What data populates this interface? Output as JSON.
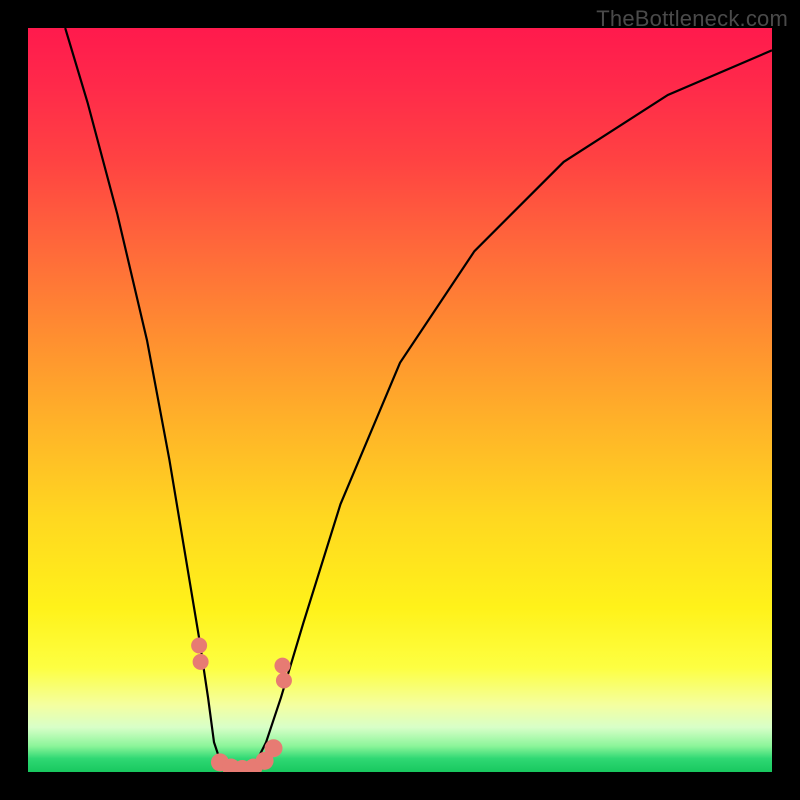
{
  "watermark": {
    "text": "TheBottleneck.com"
  },
  "chart_data": {
    "type": "line",
    "title": "",
    "xlabel": "",
    "ylabel": "",
    "xlim": [
      0,
      100
    ],
    "ylim": [
      0,
      100
    ],
    "background": {
      "type": "vertical_gradient",
      "stops": [
        {
          "pos": 0,
          "color": "#ff1a4d"
        },
        {
          "pos": 8,
          "color": "#ff2a4a"
        },
        {
          "pos": 18,
          "color": "#ff4342"
        },
        {
          "pos": 30,
          "color": "#ff6a3a"
        },
        {
          "pos": 42,
          "color": "#ff9030"
        },
        {
          "pos": 54,
          "color": "#ffb528"
        },
        {
          "pos": 66,
          "color": "#ffd820"
        },
        {
          "pos": 78,
          "color": "#fff21a"
        },
        {
          "pos": 86,
          "color": "#fdff42"
        },
        {
          "pos": 91,
          "color": "#f4ffa0"
        },
        {
          "pos": 94,
          "color": "#d8ffc8"
        },
        {
          "pos": 96.5,
          "color": "#8cf59a"
        },
        {
          "pos": 98.2,
          "color": "#2fd873"
        },
        {
          "pos": 100,
          "color": "#18c85f"
        }
      ]
    },
    "series": [
      {
        "name": "bottleneck-curve",
        "color": "#000000",
        "stroke_width": 2.2,
        "x": [
          5,
          8,
          12,
          16,
          19,
          21,
          23,
          24.2,
          25,
          26,
          27.5,
          29,
          30.5,
          32,
          34,
          37,
          42,
          50,
          60,
          72,
          86,
          100
        ],
        "y": [
          100,
          90,
          75,
          58,
          42,
          30,
          18,
          10,
          4,
          1,
          0,
          0,
          1,
          4,
          10,
          20,
          36,
          55,
          70,
          82,
          91,
          97
        ]
      }
    ],
    "markers": [
      {
        "name": "marker-left-pair-upper",
        "shape": "circle",
        "color": "#e77b73",
        "r": 8,
        "x": 23.0,
        "y": 17.0
      },
      {
        "name": "marker-left-pair-lower",
        "shape": "circle",
        "color": "#e77b73",
        "r": 8,
        "x": 23.2,
        "y": 14.8
      },
      {
        "name": "marker-right-pair-upper",
        "shape": "circle",
        "color": "#e77b73",
        "r": 8,
        "x": 34.2,
        "y": 14.3
      },
      {
        "name": "marker-right-pair-lower",
        "shape": "circle",
        "color": "#e77b73",
        "r": 8,
        "x": 34.4,
        "y": 12.3
      },
      {
        "name": "trough-marker-1",
        "shape": "circle",
        "color": "#e77b73",
        "r": 9,
        "x": 25.8,
        "y": 1.3
      },
      {
        "name": "trough-marker-2",
        "shape": "circle",
        "color": "#e77b73",
        "r": 9,
        "x": 27.3,
        "y": 0.6
      },
      {
        "name": "trough-marker-3",
        "shape": "circle",
        "color": "#e77b73",
        "r": 9,
        "x": 28.8,
        "y": 0.4
      },
      {
        "name": "trough-marker-4",
        "shape": "circle",
        "color": "#e77b73",
        "r": 9,
        "x": 30.3,
        "y": 0.6
      },
      {
        "name": "trough-marker-5",
        "shape": "circle",
        "color": "#e77b73",
        "r": 9,
        "x": 31.8,
        "y": 1.5
      },
      {
        "name": "trough-marker-6",
        "shape": "circle",
        "color": "#e77b73",
        "r": 9,
        "x": 33.0,
        "y": 3.2
      }
    ]
  }
}
